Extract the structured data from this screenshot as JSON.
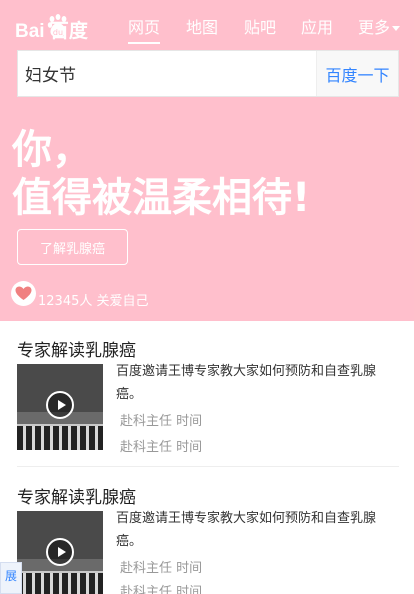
{
  "logo": {
    "text": "Bai  百度"
  },
  "nav": {
    "items": [
      {
        "label": "网页",
        "active": true
      },
      {
        "label": "地图",
        "active": false
      },
      {
        "label": "贴吧",
        "active": false
      },
      {
        "label": "应用",
        "active": false
      }
    ],
    "more_label": "更多"
  },
  "search": {
    "value": "妇女节",
    "button_label": "百度一下"
  },
  "hero": {
    "line1": "你，",
    "line2": "值得被温柔相待!",
    "learn_button": "了解乳腺癌",
    "care_text": "12345人 关爱自己",
    "background": "#ffbfcc"
  },
  "articles": [
    {
      "title": "专家解读乳腺癌",
      "description": "百度邀请王博专家教大家如何预防和自查乳腺癌。",
      "meta1": "赴科主任 时间",
      "meta2": "赴科主任 时间"
    },
    {
      "title": "专家解读乳腺癌",
      "description": "百度邀请王博专家教大家如何预防和自查乳腺癌。",
      "meta1": "赴科主任 时间",
      "meta2": "赴科主任 时间"
    }
  ],
  "expand_tab": {
    "label": "展"
  },
  "colors": {
    "accent": "#3385ff",
    "heart": "#f08080"
  }
}
